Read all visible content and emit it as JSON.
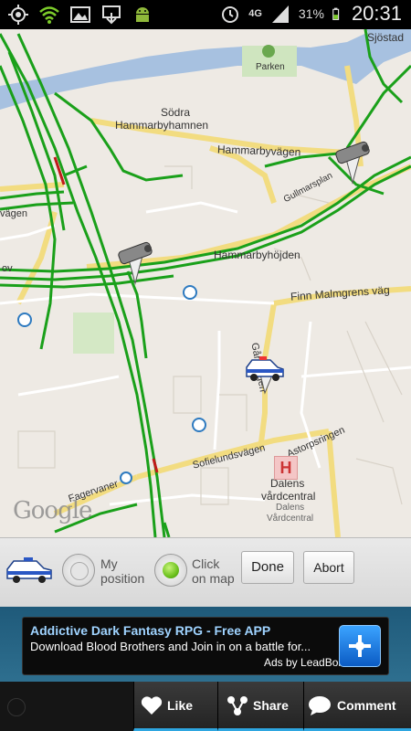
{
  "status_bar": {
    "network": "4G",
    "battery_percent": "31%",
    "time": "20:31",
    "icons": [
      "gps-icon",
      "wifi-icon",
      "gallery-icon",
      "download-icon",
      "android-icon",
      "alarm-icon",
      "signal-icon",
      "battery-icon"
    ]
  },
  "map": {
    "labels": {
      "sjostad": "Sjöstad",
      "sodra": "Södra",
      "hammarbyhamnen": "Hammarbyhamnen",
      "hammarbyvagen": "Hammarbyvägen",
      "gullmarsplan": "Gullmarsplan",
      "hammarbyhojden": "Hammarbyhöjden",
      "finn_malmgrens": "Finn Malmgrens väg",
      "sofielundsvagen": "Sofielundsvägen",
      "astorpsringen": "Astorpsringen",
      "dalens1": "Dalens",
      "dalens2": "vårdcentral",
      "dalens3": "Dalens",
      "dalens4": "Vårdcentral",
      "garvagen": "Gårdvägen",
      "fagervaner": "Fagervaner",
      "vagen": "vägen",
      "parken": "Parken",
      "ovagen": "ov"
    },
    "logo": "Google",
    "hospital_symbol": "H",
    "icons": [
      "speed-camera-icon",
      "police-car-icon"
    ]
  },
  "controls": {
    "option_my_position": "My\nposition",
    "option_click_on_map": "Click\non map",
    "selected": "click_on_map",
    "done_button": "Done",
    "abort_button": "Abort"
  },
  "ad": {
    "title": "Addictive Dark Fantasy RPG - Free APP",
    "body": "Download Blood Brothers and Join in on a battle for...",
    "byline": "Ads by LeadBolt"
  },
  "bottom_bar": {
    "like": "Like",
    "share": "Share",
    "comment": "Comment"
  }
}
